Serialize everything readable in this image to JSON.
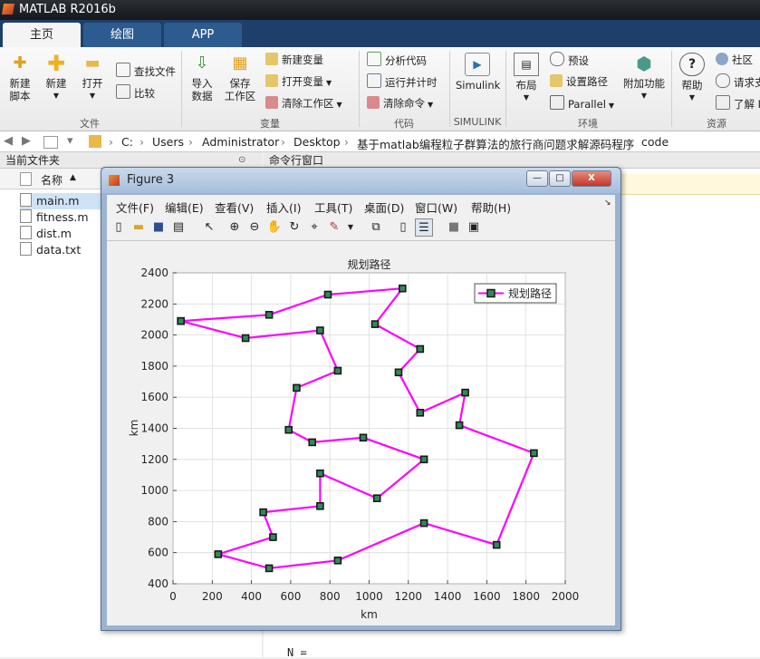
{
  "app": {
    "title": "MATLAB R2016b"
  },
  "tabs": [
    {
      "label": "主页"
    },
    {
      "label": "绘图"
    },
    {
      "label": "APP"
    }
  ],
  "ribbon": {
    "file": {
      "new_script": "新建\n脚本",
      "new": "新建",
      "open": "打开",
      "find_files": "查找文件",
      "compare": "比较",
      "group": "文件"
    },
    "variable": {
      "import": "导入\n数据",
      "save_ws": "保存\n工作区",
      "new_var": "新建变量",
      "open_var": "打开变量",
      "clear_ws": "清除工作区",
      "group": "变量"
    },
    "code": {
      "analyze": "分析代码",
      "run_time": "运行并计时",
      "clear_cmd": "清除命令",
      "group": "代码"
    },
    "simulink": {
      "label": "Simulink",
      "group": "SIMULINK"
    },
    "env": {
      "layout": "布局",
      "prefs": "预设",
      "set_path": "设置路径",
      "parallel": "Parallel",
      "addons": "附加功能",
      "group": "环境"
    },
    "resources": {
      "help": "帮助",
      "community": "社区",
      "request": "请求支",
      "learn": "了解 M",
      "group": "资源"
    }
  },
  "address": {
    "crumbs": [
      "C:",
      "Users",
      "Administrator",
      "Desktop",
      "基于matlab编程粒子群算法的旅行商问题求解源码程序",
      "code"
    ]
  },
  "file_panel": {
    "header": "当前文件夹",
    "col_name": "名称",
    "sort_marker": "▲",
    "files": [
      {
        "name": "main.m",
        "selected": true
      },
      {
        "name": "fitness.m",
        "selected": false
      },
      {
        "name": "dist.m",
        "selected": false
      },
      {
        "name": "data.txt",
        "selected": false
      }
    ]
  },
  "command_window": {
    "header": "命令行窗口",
    "bottom_line": "N ="
  },
  "figure": {
    "title": "Figure 3",
    "menu": [
      "文件(F)",
      "编辑(E)",
      "查看(V)",
      "插入(I)",
      "工具(T)",
      "桌面(D)",
      "窗口(W)",
      "帮助(H)"
    ],
    "window_buttons": {
      "minimize": "—",
      "maximize": "□",
      "close": "X"
    }
  },
  "chart_data": {
    "type": "line",
    "title": "规划路径",
    "xlabel": "km",
    "ylabel": "km",
    "xlim": [
      0,
      2000
    ],
    "ylim": [
      400,
      2400
    ],
    "xticks": [
      0,
      200,
      400,
      600,
      800,
      1000,
      1200,
      1400,
      1600,
      1800,
      2000
    ],
    "yticks": [
      400,
      600,
      800,
      1000,
      1200,
      1400,
      1600,
      1800,
      2000,
      2200,
      2400
    ],
    "grid": true,
    "legend": {
      "position": "top-right",
      "entries": [
        "规划路径"
      ]
    },
    "line_color": "#ff00ff",
    "marker_edge": "#1a1a1a",
    "marker_face": "#2e8b57",
    "series": [
      {
        "name": "规划路径",
        "points": [
          [
            40,
            2090
          ],
          [
            490,
            2130
          ],
          [
            790,
            2260
          ],
          [
            1170,
            2300
          ],
          [
            1030,
            2070
          ],
          [
            1260,
            1910
          ],
          [
            1150,
            1760
          ],
          [
            1260,
            1500
          ],
          [
            1490,
            1630
          ],
          [
            1460,
            1420
          ],
          [
            1840,
            1240
          ],
          [
            1650,
            650
          ],
          [
            1280,
            790
          ],
          [
            840,
            550
          ],
          [
            490,
            500
          ],
          [
            230,
            590
          ],
          [
            510,
            700
          ],
          [
            460,
            860
          ],
          [
            750,
            900
          ],
          [
            750,
            1110
          ],
          [
            1040,
            950
          ],
          [
            1280,
            1200
          ],
          [
            970,
            1340
          ],
          [
            710,
            1310
          ],
          [
            590,
            1390
          ],
          [
            630,
            1660
          ],
          [
            840,
            1770
          ],
          [
            750,
            2030
          ],
          [
            370,
            1980
          ],
          [
            40,
            2090
          ]
        ]
      }
    ]
  }
}
